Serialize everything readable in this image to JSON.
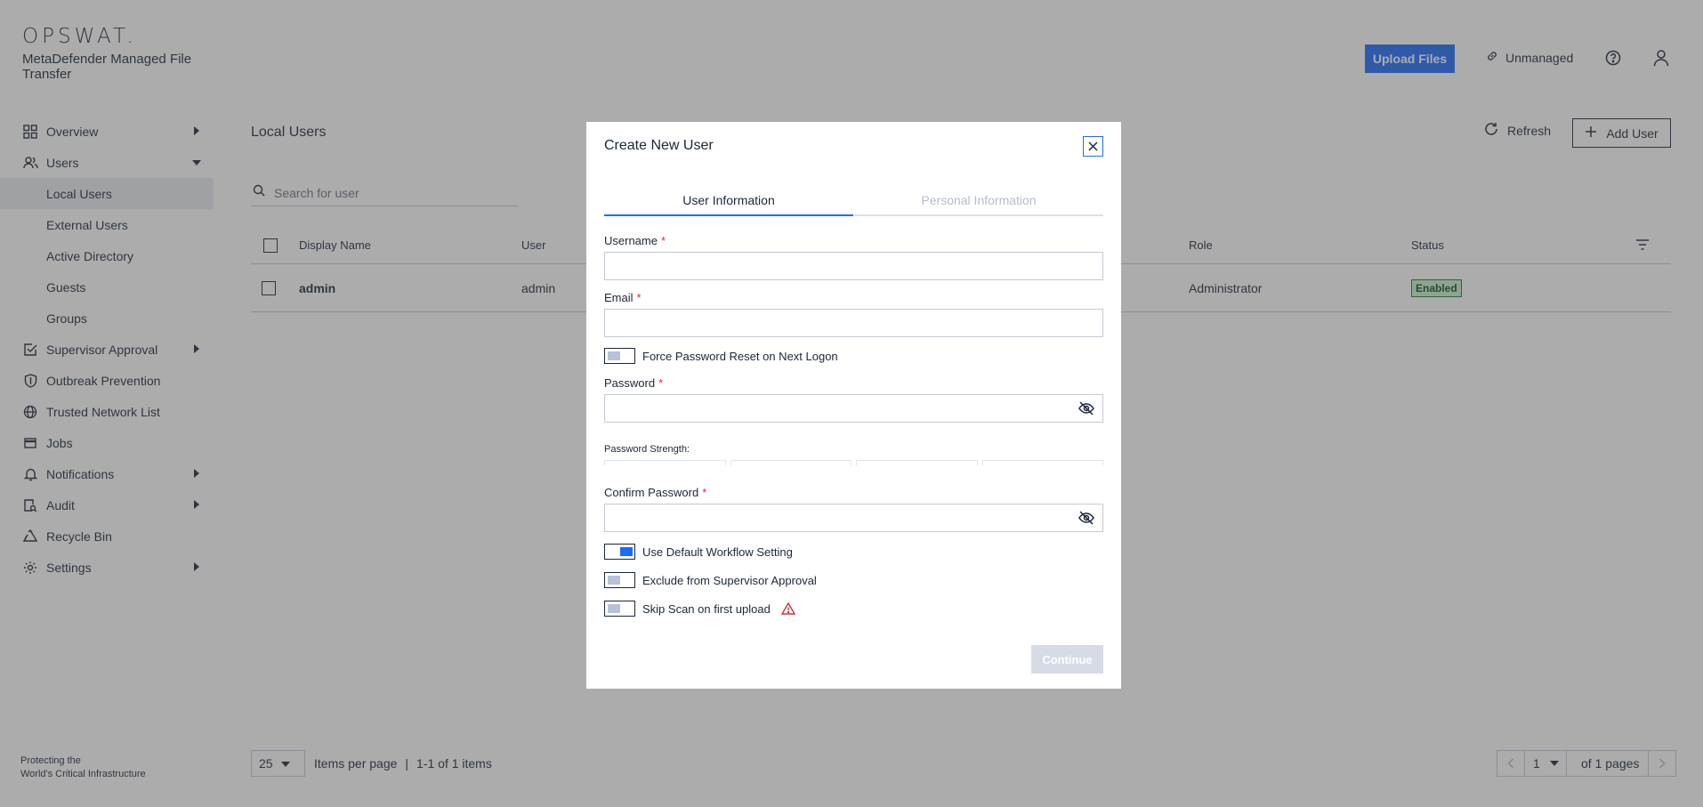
{
  "brand": {
    "logo": "OPSWAT.",
    "product": "MetaDefender Managed File Transfer"
  },
  "header": {
    "upload_label": "Upload Files",
    "managed_status": "Unmanaged"
  },
  "sidebar": {
    "items": [
      {
        "label": "Overview"
      },
      {
        "label": "Users"
      },
      {
        "label": "Local Users"
      },
      {
        "label": "External Users"
      },
      {
        "label": "Active Directory"
      },
      {
        "label": "Guests"
      },
      {
        "label": "Groups"
      },
      {
        "label": "Supervisor Approval"
      },
      {
        "label": "Outbreak Prevention"
      },
      {
        "label": "Trusted Network List"
      },
      {
        "label": "Jobs"
      },
      {
        "label": "Notifications"
      },
      {
        "label": "Audit"
      },
      {
        "label": "Recycle Bin"
      },
      {
        "label": "Settings"
      }
    ],
    "footer_line1": "Protecting the",
    "footer_line2": "World's Critical Infrastructure"
  },
  "main": {
    "title": "Local Users",
    "refresh_label": "Refresh",
    "add_user_label": "Add User",
    "search_placeholder": "Search for user",
    "table": {
      "columns": [
        "Display Name",
        "User",
        "Role",
        "Status"
      ],
      "rows": [
        {
          "display_name": "admin",
          "user": "admin",
          "role": "Administrator",
          "status": "Enabled"
        }
      ]
    },
    "pagination": {
      "per_page": "25",
      "items_per_page_label": "Items per page",
      "range": "1-1 of 1 items",
      "page": "1",
      "of_pages": "of 1 pages"
    }
  },
  "modal": {
    "title": "Create New User",
    "tabs": [
      {
        "label": "User Information"
      },
      {
        "label": "Personal Information"
      }
    ],
    "username_label": "Username",
    "email_label": "Email",
    "required_mark": "*",
    "force_reset_label": "Force Password Reset on Next Logon",
    "force_reset_on": false,
    "password_label": "Password",
    "password_strength_label": "Password Strength:",
    "confirm_password_label": "Confirm Password",
    "default_workflow_label": "Use Default Workflow Setting",
    "default_workflow_on": true,
    "exclude_supervisor_label": "Exclude from Supervisor Approval",
    "exclude_supervisor_on": false,
    "skip_scan_label": "Skip Scan on first upload",
    "skip_scan_on": false,
    "continue_label": "Continue"
  },
  "colors": {
    "accent": "#1d6bfc",
    "required": "#d0303c",
    "enabled_badge": "#c9f0cf",
    "warning": "#d0303c"
  }
}
